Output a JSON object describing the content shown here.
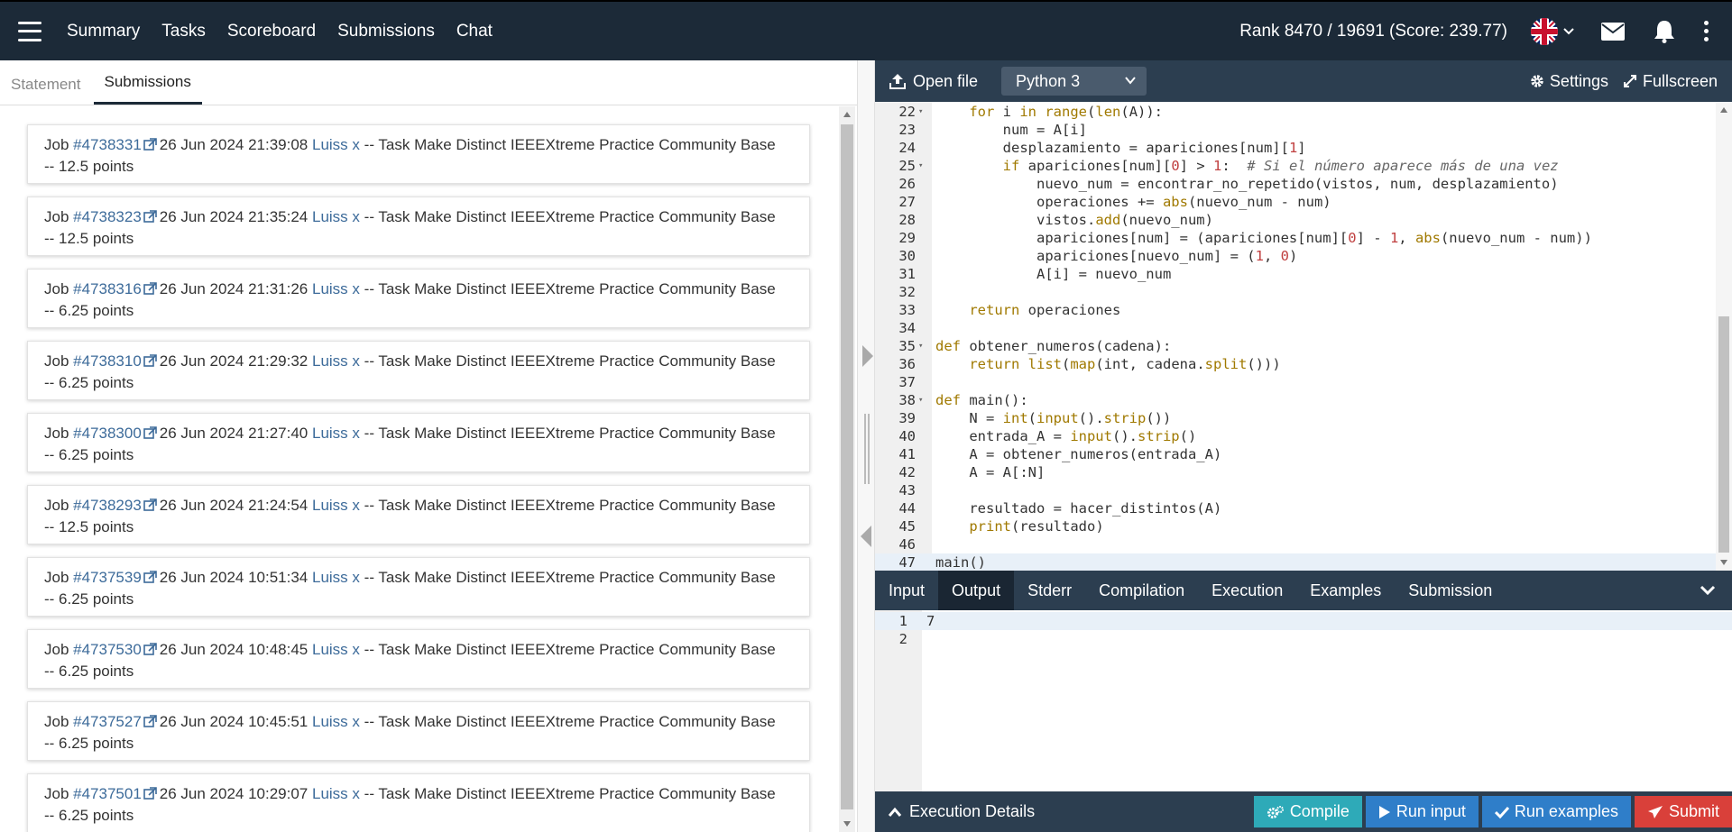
{
  "navbar": {
    "links": [
      "Summary",
      "Tasks",
      "Scoreboard",
      "Submissions",
      "Chat"
    ],
    "rank": "Rank 8470 / 19691 (Score: 239.77)"
  },
  "left": {
    "tabs": [
      {
        "label": "Statement",
        "active": false
      },
      {
        "label": "Submissions",
        "active": true
      }
    ],
    "submissions": [
      {
        "prefix": "Job ",
        "job": "#4738331",
        "datetime": "26 Jun 2024 21:39:08",
        "user": "Luiss x",
        "task": "-- Task Make Distinct IEEEXtreme Practice Community Base",
        "points": "-- 12.5 points"
      },
      {
        "prefix": "Job ",
        "job": "#4738323",
        "datetime": "26 Jun 2024 21:35:24",
        "user": "Luiss x",
        "task": "-- Task Make Distinct IEEEXtreme Practice Community Base",
        "points": "-- 12.5 points"
      },
      {
        "prefix": "Job ",
        "job": "#4738316",
        "datetime": "26 Jun 2024 21:31:26",
        "user": "Luiss x",
        "task": "-- Task Make Distinct IEEEXtreme Practice Community Base",
        "points": "-- 6.25 points"
      },
      {
        "prefix": "Job ",
        "job": "#4738310",
        "datetime": "26 Jun 2024 21:29:32",
        "user": "Luiss x",
        "task": "-- Task Make Distinct IEEEXtreme Practice Community Base",
        "points": "-- 6.25 points"
      },
      {
        "prefix": "Job ",
        "job": "#4738300",
        "datetime": "26 Jun 2024 21:27:40",
        "user": "Luiss x",
        "task": "-- Task Make Distinct IEEEXtreme Practice Community Base",
        "points": "-- 6.25 points"
      },
      {
        "prefix": "Job ",
        "job": "#4738293",
        "datetime": "26 Jun 2024 21:24:54",
        "user": "Luiss x",
        "task": "-- Task Make Distinct IEEEXtreme Practice Community Base",
        "points": "-- 12.5 points"
      },
      {
        "prefix": "Job ",
        "job": "#4737539",
        "datetime": "26 Jun 2024 10:51:34",
        "user": "Luiss x",
        "task": "-- Task Make Distinct IEEEXtreme Practice Community Base",
        "points": "-- 6.25 points"
      },
      {
        "prefix": "Job ",
        "job": "#4737530",
        "datetime": "26 Jun 2024 10:48:45",
        "user": "Luiss x",
        "task": "-- Task Make Distinct IEEEXtreme Practice Community Base",
        "points": "-- 6.25 points"
      },
      {
        "prefix": "Job ",
        "job": "#4737527",
        "datetime": "26 Jun 2024 10:45:51",
        "user": "Luiss x",
        "task": "-- Task Make Distinct IEEEXtreme Practice Community Base",
        "points": "-- 6.25 points"
      },
      {
        "prefix": "Job ",
        "job": "#4737501",
        "datetime": "26 Jun 2024 10:29:07",
        "user": "Luiss x",
        "task": "-- Task Make Distinct IEEEXtreme Practice Community Base",
        "points": "-- 6.25 points"
      }
    ]
  },
  "editor_bar": {
    "open_file": "Open file",
    "language": "Python 3",
    "settings": "Settings",
    "fullscreen": "Fullscreen"
  },
  "code": [
    {
      "n": "22",
      "fold": true,
      "text": "    for i in range(len(A)):"
    },
    {
      "n": "23",
      "fold": false,
      "text": "        num = A[i]"
    },
    {
      "n": "24",
      "fold": false,
      "text": "        desplazamiento = apariciones[num][1]"
    },
    {
      "n": "25",
      "fold": true,
      "text": "        if apariciones[num][0] > 1:  # Si el número aparece más de una vez"
    },
    {
      "n": "26",
      "fold": false,
      "text": "            nuevo_num = encontrar_no_repetido(vistos, num, desplazamiento)"
    },
    {
      "n": "27",
      "fold": false,
      "text": "            operaciones += abs(nuevo_num - num)"
    },
    {
      "n": "28",
      "fold": false,
      "text": "            vistos.add(nuevo_num)"
    },
    {
      "n": "29",
      "fold": false,
      "text": "            apariciones[num] = (apariciones[num][0] - 1, abs(nuevo_num - num))"
    },
    {
      "n": "30",
      "fold": false,
      "text": "            apariciones[nuevo_num] = (1, 0)"
    },
    {
      "n": "31",
      "fold": false,
      "text": "            A[i] = nuevo_num"
    },
    {
      "n": "32",
      "fold": false,
      "text": ""
    },
    {
      "n": "33",
      "fold": false,
      "text": "    return operaciones"
    },
    {
      "n": "34",
      "fold": false,
      "text": ""
    },
    {
      "n": "35",
      "fold": true,
      "text": "def obtener_numeros(cadena):"
    },
    {
      "n": "36",
      "fold": false,
      "text": "    return list(map(int, cadena.split()))"
    },
    {
      "n": "37",
      "fold": false,
      "text": ""
    },
    {
      "n": "38",
      "fold": true,
      "text": "def main():"
    },
    {
      "n": "39",
      "fold": false,
      "text": "    N = int(input().strip())"
    },
    {
      "n": "40",
      "fold": false,
      "text": "    entrada_A = input().strip()"
    },
    {
      "n": "41",
      "fold": false,
      "text": "    A = obtener_numeros(entrada_A)"
    },
    {
      "n": "42",
      "fold": false,
      "text": "    A = A[:N]"
    },
    {
      "n": "43",
      "fold": false,
      "text": ""
    },
    {
      "n": "44",
      "fold": false,
      "text": "    resultado = hacer_distintos(A)"
    },
    {
      "n": "45",
      "fold": false,
      "text": "    print(resultado)"
    },
    {
      "n": "46",
      "fold": false,
      "text": ""
    },
    {
      "n": "47",
      "fold": false,
      "text": "main()"
    }
  ],
  "io_tabs": [
    {
      "label": "Input",
      "active": false
    },
    {
      "label": "Output",
      "active": true
    },
    {
      "label": "Stderr",
      "active": false
    },
    {
      "label": "Compilation",
      "active": false
    },
    {
      "label": "Execution",
      "active": false
    },
    {
      "label": "Examples",
      "active": false
    },
    {
      "label": "Submission",
      "active": false
    }
  ],
  "output": [
    {
      "n": "1",
      "text": "7"
    },
    {
      "n": "2",
      "text": ""
    }
  ],
  "bottom": {
    "execution_details": "Execution Details",
    "compile": "Compile",
    "run_input": "Run input",
    "run_examples": "Run examples",
    "submit": "Submit"
  },
  "colors": {
    "navbar": "#1c2a38",
    "toolbar": "#2c3e50",
    "link": "#3d6b9a",
    "compile": "#2eaab8",
    "run": "#2f7ec9",
    "submit": "#d9403a"
  },
  "icons": [
    "menu-icon",
    "uk-flag-icon",
    "envelope-icon",
    "bell-icon",
    "kebab-icon",
    "external-link-icon",
    "upload-icon",
    "gear-icon",
    "expand-icon",
    "chevron-up-icon",
    "chevron-down-icon",
    "cogs-icon",
    "play-icon",
    "check-icon",
    "paper-plane-icon"
  ]
}
